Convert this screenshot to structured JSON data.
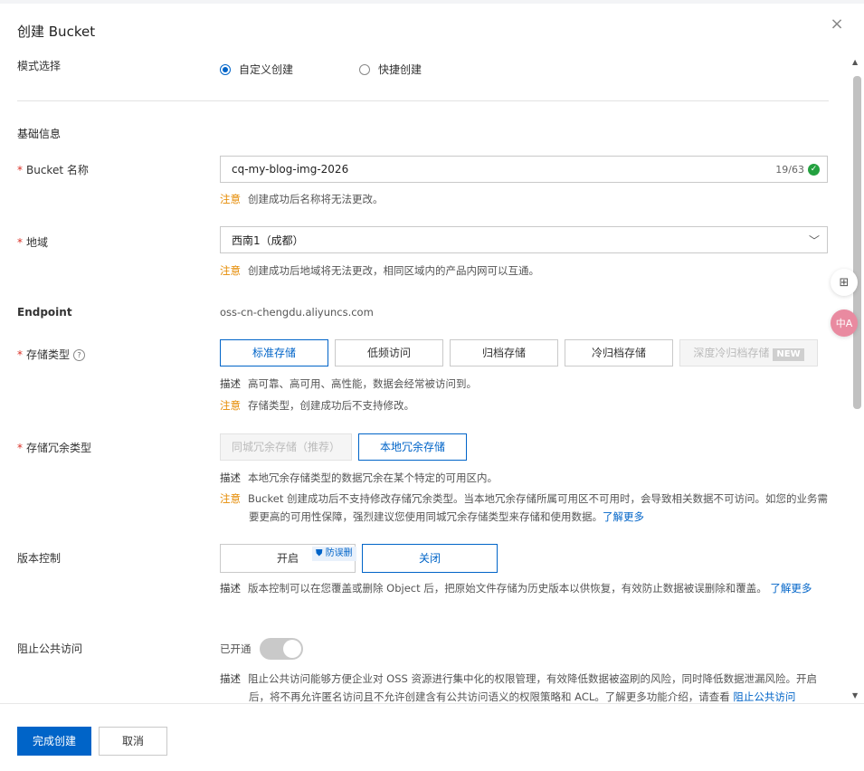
{
  "dialog": {
    "title": "创建 Bucket",
    "close_glyph": "×"
  },
  "mode": {
    "label": "模式选择",
    "options": [
      "自定义创建",
      "快捷创建"
    ],
    "selected": "自定义创建"
  },
  "section": {
    "basic": "基础信息"
  },
  "bucket_name": {
    "label": "Bucket 名称",
    "value": "cq-my-blog-img-2026",
    "counter": "19/63",
    "note_key": "注意",
    "note": "创建成功后名称将无法更改。"
  },
  "region": {
    "label": "地域",
    "value": "西南1（成都）",
    "note_key": "注意",
    "note": "创建成功后地域将无法更改，相同区域内的产品内网可以互通。"
  },
  "endpoint": {
    "label": "Endpoint",
    "value": "oss-cn-chengdu.aliyuncs.com"
  },
  "storage_class": {
    "label": "存储类型",
    "options": [
      "标准存储",
      "低频访问",
      "归档存储",
      "冷归档存储",
      "深度冷归档存储"
    ],
    "new_tag": "NEW",
    "selected": "标准存储",
    "desc_key": "描述",
    "desc": "高可靠、高可用、高性能，数据会经常被访问到。",
    "note_key": "注意",
    "note": "存储类型，创建成功后不支持修改。"
  },
  "redundancy": {
    "label": "存储冗余类型",
    "options": [
      "同城冗余存储（推荐）",
      "本地冗余存储"
    ],
    "selected": "本地冗余存储",
    "desc_key": "描述",
    "desc": "本地冗余存储类型的数据冗余在某个特定的可用区内。",
    "note_key": "注意",
    "note": "Bucket 创建成功后不支持修改存储冗余类型。当本地冗余存储所属可用区不可用时，会导致相关数据不可访问。如您的业务需要更高的可用性保障，强烈建议您使用同城冗余存储类型来存储和使用数据。",
    "link": "了解更多"
  },
  "versioning": {
    "label": "版本控制",
    "options": [
      "开启",
      "关闭"
    ],
    "selected": "关闭",
    "badge": "防误删",
    "desc_key": "描述",
    "desc": "版本控制可以在您覆盖或删除 Object 后，把原始文件存储为历史版本以供恢复，有效防止数据被误删除和覆盖。",
    "link": "了解更多"
  },
  "public_block": {
    "label": "阻止公共访问",
    "status": "已开通",
    "enabled": true,
    "desc_key": "描述",
    "desc": "阻止公共访问能够方便企业对 OSS 资源进行集中化的权限管理，有效降低数据被盗刷的风险，同时降低数据泄漏风险。开启后，将不再允许匿名访问且不允许创建含有公共访问语义的权限策略和 ACL。了解更多功能介绍，请查看",
    "link": "阻止公共访问"
  },
  "footer": {
    "confirm": "完成创建",
    "cancel": "取消"
  },
  "floating": {
    "grid_icon": "grid-icon",
    "translate_label": "中A"
  },
  "colors": {
    "primary": "#0064c8",
    "warn": "#e58a00",
    "success": "#23a13f",
    "required": "#d93026"
  }
}
